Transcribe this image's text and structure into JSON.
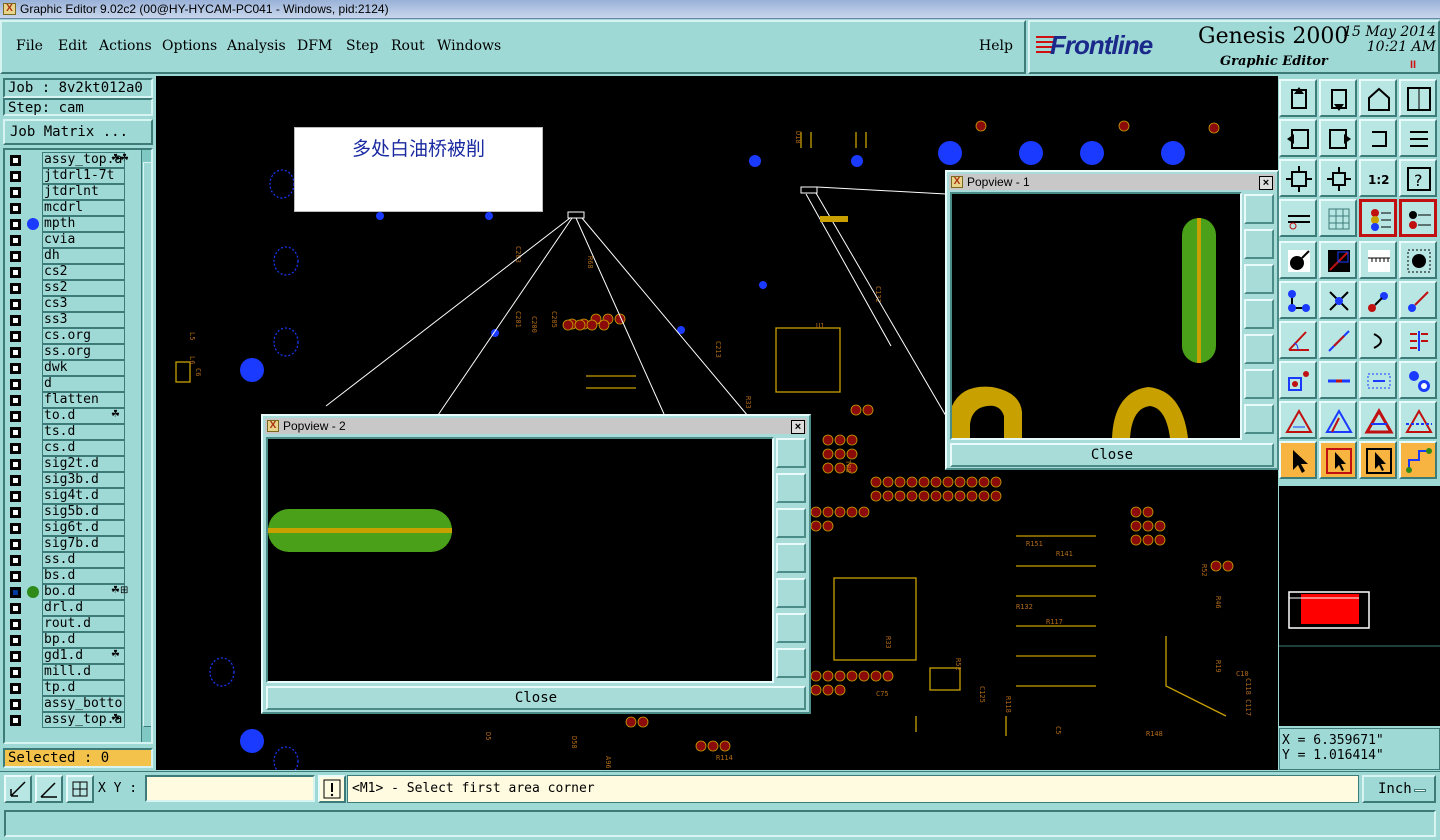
{
  "window": {
    "title": "Graphic Editor 9.02c2 (00@HY-HYCAM-PC041 - Windows, pid:2124)"
  },
  "menu": {
    "file": "File",
    "edit": "Edit",
    "actions": "Actions",
    "options": "Options",
    "analysis": "Analysis",
    "dfm": "DFM",
    "step": "Step",
    "rout": "Rout",
    "windows": "Windows",
    "help": "Help"
  },
  "brand": {
    "logo": "Frontline",
    "product": "Genesis 2000",
    "subtitle": "Graphic Editor",
    "date": "15 May 2014",
    "time": "10:21 AM",
    "pause_glyph": "II"
  },
  "job": {
    "job_label": "Job : 8v2kt012a0",
    "step_label": "Step: cam",
    "matrix_button": "Job Matrix ..."
  },
  "layers": [
    {
      "name": "assy_top.a",
      "checked": false,
      "dot": "",
      "tag": "☘☘"
    },
    {
      "name": "jtdrl1-7t",
      "checked": false,
      "dot": "",
      "tag": ""
    },
    {
      "name": "jtdrlnt",
      "checked": false,
      "dot": "",
      "tag": ""
    },
    {
      "name": "mcdrl",
      "checked": false,
      "dot": "",
      "tag": ""
    },
    {
      "name": "mpth",
      "checked": false,
      "dot": "#1a3aff",
      "tag": ""
    },
    {
      "name": "cvia",
      "checked": false,
      "dot": "",
      "tag": ""
    },
    {
      "name": "dh",
      "checked": false,
      "dot": "",
      "tag": ""
    },
    {
      "name": "cs2",
      "checked": false,
      "dot": "",
      "tag": ""
    },
    {
      "name": "ss2",
      "checked": false,
      "dot": "",
      "tag": ""
    },
    {
      "name": "cs3",
      "checked": false,
      "dot": "",
      "tag": ""
    },
    {
      "name": "ss3",
      "checked": false,
      "dot": "",
      "tag": ""
    },
    {
      "name": "cs.org",
      "checked": false,
      "dot": "",
      "tag": ""
    },
    {
      "name": "ss.org",
      "checked": false,
      "dot": "",
      "tag": ""
    },
    {
      "name": "dwk",
      "checked": false,
      "dot": "",
      "tag": ""
    },
    {
      "name": "d",
      "checked": false,
      "dot": "",
      "tag": ""
    },
    {
      "name": "flatten",
      "checked": false,
      "dot": "",
      "tag": ""
    },
    {
      "name": "to.d",
      "checked": false,
      "dot": "",
      "tag": "☘"
    },
    {
      "name": "ts.d",
      "checked": false,
      "dot": "",
      "tag": ""
    },
    {
      "name": "cs.d",
      "checked": false,
      "dot": "",
      "tag": ""
    },
    {
      "name": "sig2t.d",
      "checked": false,
      "dot": "",
      "tag": ""
    },
    {
      "name": "sig3b.d",
      "checked": false,
      "dot": "",
      "tag": ""
    },
    {
      "name": "sig4t.d",
      "checked": false,
      "dot": "",
      "tag": ""
    },
    {
      "name": "sig5b.d",
      "checked": false,
      "dot": "",
      "tag": ""
    },
    {
      "name": "sig6t.d",
      "checked": false,
      "dot": "",
      "tag": ""
    },
    {
      "name": "sig7b.d",
      "checked": false,
      "dot": "",
      "tag": ""
    },
    {
      "name": "ss.d",
      "checked": false,
      "dot": "",
      "tag": ""
    },
    {
      "name": "bs.d",
      "checked": false,
      "dot": "",
      "tag": ""
    },
    {
      "name": "bo.d",
      "checked": true,
      "dot": "#2e8b1a",
      "tag": "☘⊞"
    },
    {
      "name": "drl.d",
      "checked": false,
      "dot": "",
      "tag": ""
    },
    {
      "name": "rout.d",
      "checked": false,
      "dot": "",
      "tag": ""
    },
    {
      "name": "bp.d",
      "checked": false,
      "dot": "",
      "tag": ""
    },
    {
      "name": "gd1.d",
      "checked": false,
      "dot": "",
      "tag": "☘"
    },
    {
      "name": "mill.d",
      "checked": false,
      "dot": "",
      "tag": ""
    },
    {
      "name": "tp.d",
      "checked": false,
      "dot": "",
      "tag": ""
    },
    {
      "name": "assy_botto",
      "checked": false,
      "dot": "",
      "tag": ""
    },
    {
      "name": "assy_top.a",
      "checked": false,
      "dot": "",
      "tag": "☘"
    }
  ],
  "selected": {
    "label": "Selected : 0"
  },
  "canvas": {
    "note": "多处白油桥被削"
  },
  "popview1": {
    "title": "Popview - 1",
    "close": "Close"
  },
  "popview2": {
    "title": "Popview - 2",
    "close": "Close"
  },
  "coords": {
    "x": "X = 6.359671\"",
    "y": "Y = 1.016414\""
  },
  "status": {
    "xy_label": "X Y :",
    "xy_value": "",
    "message": "<M1> - Select first area corner",
    "units": "Inch"
  },
  "colors": {
    "accent": "#9fd9d6",
    "pad_green": "#4aa018",
    "pad_gold": "#c8a000",
    "via_blue": "#1a3aff",
    "highlight_red": "#c01010"
  }
}
